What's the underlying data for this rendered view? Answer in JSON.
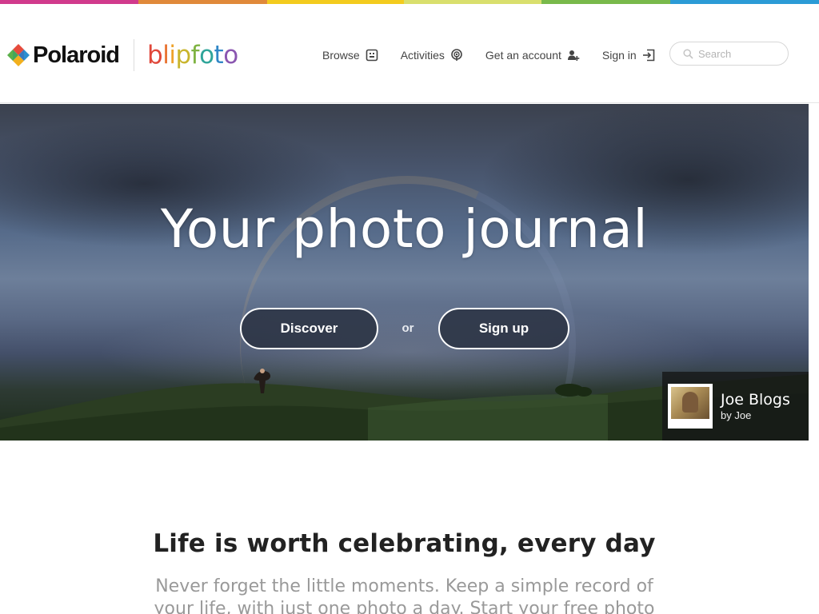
{
  "rainbow_colors": [
    "#d13a8c",
    "#e0893a",
    "#f3cb1e",
    "#d9df6d",
    "#79b94b",
    "#2b9bd6"
  ],
  "brand": {
    "polaroid": "Polaroid",
    "blipfoto_letters": [
      {
        "ch": "b",
        "color": "#e0473a"
      },
      {
        "ch": "l",
        "color": "#e8712f"
      },
      {
        "ch": "i",
        "color": "#eea22a"
      },
      {
        "ch": "p",
        "color": "#c9b52c"
      },
      {
        "ch": "f",
        "color": "#7fb342"
      },
      {
        "ch": "o",
        "color": "#2fa59a"
      },
      {
        "ch": "t",
        "color": "#2f86c6"
      },
      {
        "ch": "o",
        "color": "#8a56b0"
      }
    ]
  },
  "nav": {
    "browse": {
      "label": "Browse",
      "icon": "grid-icon"
    },
    "activities": {
      "label": "Activities",
      "icon": "broadcast-icon"
    },
    "get_account": {
      "label": "Get an account",
      "icon": "add-user-icon"
    },
    "sign_in": {
      "label": "Sign in",
      "icon": "sign-in-icon"
    }
  },
  "search": {
    "placeholder": "Search"
  },
  "hero": {
    "title": "Your photo journal",
    "discover_label": "Discover",
    "or_label": "or",
    "signup_label": "Sign up",
    "featured": {
      "title": "Joe Blogs",
      "byline": "by Joe"
    }
  },
  "section": {
    "tagline": "Life is worth celebrating, every day",
    "intro": "Never forget the little moments. Keep a simple record of your life, with just one photo a day. Start your free photo"
  }
}
